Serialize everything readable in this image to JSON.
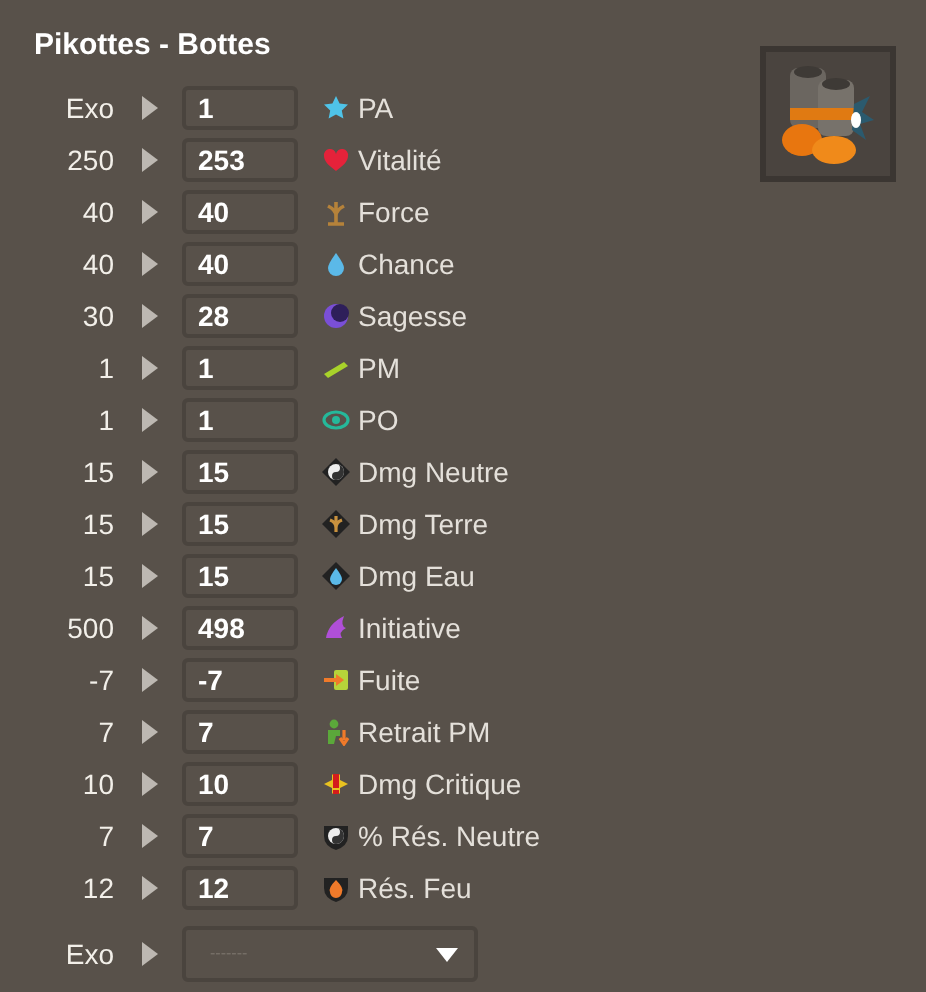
{
  "title": "Pikottes - Bottes",
  "rows": [
    {
      "kind": "stat",
      "base": "Exo",
      "value": "1",
      "label": "PA"
    },
    {
      "kind": "stat",
      "base": "250",
      "value": "253",
      "label": "Vitalité"
    },
    {
      "kind": "stat",
      "base": "40",
      "value": "40",
      "label": "Force"
    },
    {
      "kind": "stat",
      "base": "40",
      "value": "40",
      "label": "Chance"
    },
    {
      "kind": "stat",
      "base": "30",
      "value": "28",
      "label": "Sagesse"
    },
    {
      "kind": "stat",
      "base": "1",
      "value": "1",
      "label": "PM"
    },
    {
      "kind": "stat",
      "base": "1",
      "value": "1",
      "label": "PO"
    },
    {
      "kind": "stat",
      "base": "15",
      "value": "15",
      "label": "Dmg Neutre"
    },
    {
      "kind": "stat",
      "base": "15",
      "value": "15",
      "label": "Dmg Terre"
    },
    {
      "kind": "stat",
      "base": "15",
      "value": "15",
      "label": "Dmg Eau"
    },
    {
      "kind": "stat",
      "base": "500",
      "value": "498",
      "label": "Initiative"
    },
    {
      "kind": "stat",
      "base": "-7",
      "value": "-7",
      "label": "Fuite"
    },
    {
      "kind": "stat",
      "base": "7",
      "value": "7",
      "label": "Retrait PM"
    },
    {
      "kind": "stat",
      "base": "10",
      "value": "10",
      "label": "Dmg Critique"
    },
    {
      "kind": "stat",
      "base": "7",
      "value": "7",
      "label": "% Rés. Neutre"
    },
    {
      "kind": "stat",
      "base": "12",
      "value": "12",
      "label": "Rés. Feu"
    },
    {
      "kind": "select",
      "base": "Exo",
      "placeholder": "-------"
    }
  ]
}
